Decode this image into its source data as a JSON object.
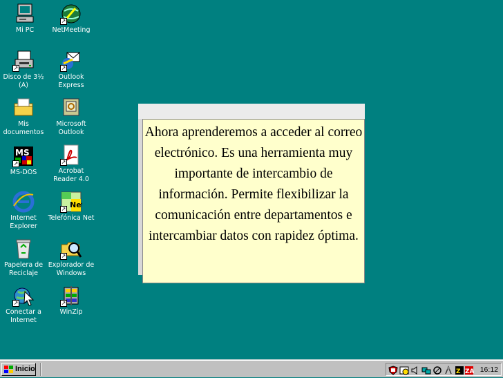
{
  "desktop": {
    "icons": [
      {
        "label": "Mi PC",
        "icon": "computer-icon"
      },
      {
        "label": "NetMeeting",
        "icon": "netmeeting-icon"
      },
      {
        "label": "Disco de 3½ (A)",
        "icon": "floppy-drive-icon"
      },
      {
        "label": "Outlook Express",
        "icon": "outlook-express-icon"
      },
      {
        "label": "Mis documentos",
        "icon": "folder-icon"
      },
      {
        "label": "Microsoft Outlook",
        "icon": "outlook-icon"
      },
      {
        "label": "MS-DOS",
        "icon": "msdos-icon"
      },
      {
        "label": "Acrobat Reader 4.0",
        "icon": "acrobat-icon"
      },
      {
        "label": "Internet Explorer",
        "icon": "internet-explorer-icon"
      },
      {
        "label": "Telefónica Net",
        "icon": "telefonica-net-icon"
      },
      {
        "label": "Papelera de Reciclaje",
        "icon": "recycle-bin-icon"
      },
      {
        "label": "Explorador de Windows",
        "icon": "windows-explorer-icon"
      },
      {
        "label": "Conectar a Internet",
        "icon": "connect-internet-icon"
      },
      {
        "label": "WinZip",
        "icon": "winzip-icon"
      }
    ]
  },
  "callout": {
    "text": "Ahora aprenderemos a acceder al correo electrónico. Es una herramienta muy importante de intercambio de información. Permite flexibilizar la comunicación entre departamentos e intercambiar datos con rapidez óptima."
  },
  "taskbar": {
    "start_label": "Inicio",
    "tray_icons": [
      "shield-icon",
      "task-scheduler-icon",
      "volume-icon",
      "network-icon",
      "monitor-icon",
      "satellite-icon",
      "zip-icon",
      "zonealarm-icon"
    ],
    "clock": "16:12"
  },
  "colors": {
    "desktop": "#008080",
    "taskbar": "#c0c0c0",
    "callout": "#ffffcc"
  }
}
